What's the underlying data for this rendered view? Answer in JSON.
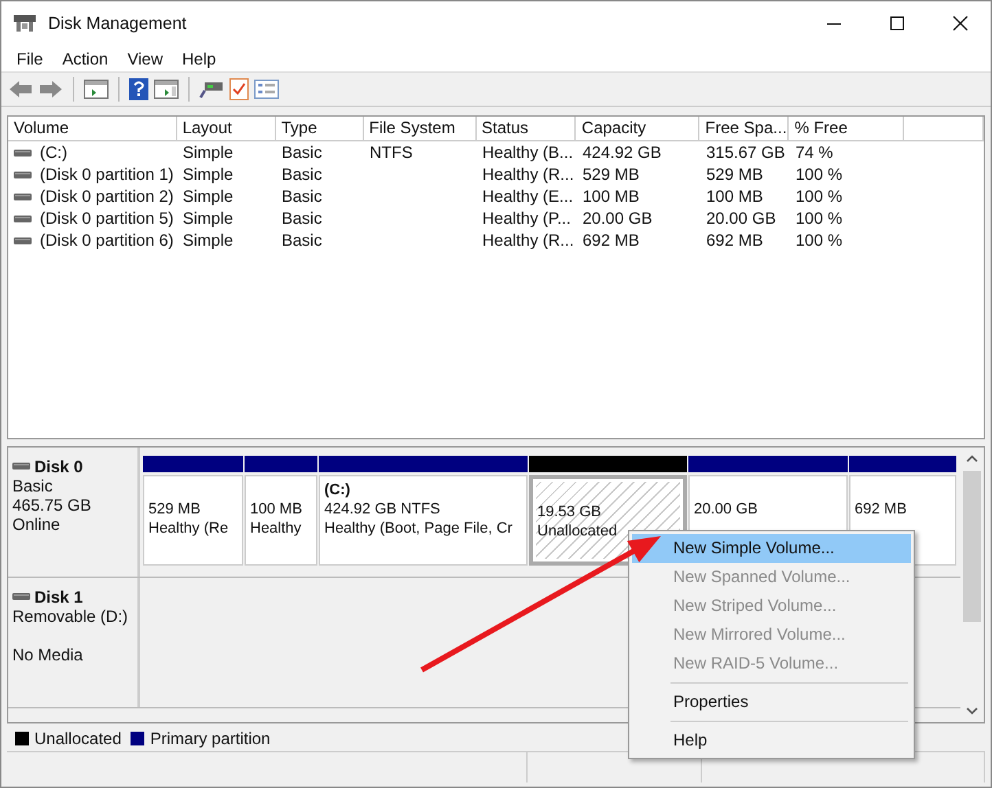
{
  "window": {
    "title": "Disk Management"
  },
  "menu": [
    "File",
    "Action",
    "View",
    "Help"
  ],
  "table": {
    "columns": [
      "Volume",
      "Layout",
      "Type",
      "File System",
      "Status",
      "Capacity",
      "Free Spa...",
      "% Free"
    ],
    "rows": [
      [
        "(C:)",
        "Simple",
        "Basic",
        "NTFS",
        "Healthy (B...",
        "424.92 GB",
        "315.67 GB",
        "74 %"
      ],
      [
        "(Disk 0 partition 1)",
        "Simple",
        "Basic",
        "",
        "Healthy (R...",
        "529 MB",
        "529 MB",
        "100 %"
      ],
      [
        "(Disk 0 partition 2)",
        "Simple",
        "Basic",
        "",
        "Healthy (E...",
        "100 MB",
        "100 MB",
        "100 %"
      ],
      [
        "(Disk 0 partition 5)",
        "Simple",
        "Basic",
        "",
        "Healthy (P...",
        "20.00 GB",
        "20.00 GB",
        "100 %"
      ],
      [
        "(Disk 0 partition 6)",
        "Simple",
        "Basic",
        "",
        "Healthy (R...",
        "692 MB",
        "692 MB",
        "100 %"
      ]
    ]
  },
  "disks": [
    {
      "name": "Disk 0",
      "type": "Basic",
      "size": "465.75 GB",
      "state": "Online",
      "partitions": [
        {
          "kind": "primary",
          "selected": false,
          "size": "529 MB",
          "status": "Healthy (Re"
        },
        {
          "kind": "primary",
          "selected": false,
          "size": "100 MB",
          "status": "Healthy"
        },
        {
          "kind": "primary",
          "selected": false,
          "name": "(C:)",
          "size": "424.92 GB NTFS",
          "status": "Healthy (Boot, Page File, Cr"
        },
        {
          "kind": "unallocated",
          "selected": true,
          "size": "19.53 GB",
          "status": "Unallocated"
        },
        {
          "kind": "primary",
          "selected": false,
          "size": "20.00 GB"
        },
        {
          "kind": "primary",
          "selected": false,
          "size": "692 MB"
        }
      ]
    },
    {
      "name": "Disk 1",
      "type": "Removable (D:)",
      "state": "No Media"
    }
  ],
  "legend": [
    {
      "label": "Unallocated",
      "color": "#000000"
    },
    {
      "label": "Primary partition",
      "color": "#000080"
    }
  ],
  "context_menu": [
    {
      "kind": "item",
      "label": "New Simple Volume...",
      "selected": true,
      "disabled": false
    },
    {
      "kind": "item",
      "label": "New Spanned Volume...",
      "selected": false,
      "disabled": true
    },
    {
      "kind": "item",
      "label": "New Striped Volume...",
      "selected": false,
      "disabled": true
    },
    {
      "kind": "item",
      "label": "New Mirrored Volume...",
      "selected": false,
      "disabled": true
    },
    {
      "kind": "item",
      "label": "New RAID-5 Volume...",
      "selected": false,
      "disabled": true
    },
    {
      "kind": "separator"
    },
    {
      "kind": "item",
      "label": "Properties",
      "selected": false,
      "disabled": false
    },
    {
      "kind": "separator"
    },
    {
      "kind": "item",
      "label": "Help",
      "selected": false,
      "disabled": false
    }
  ]
}
